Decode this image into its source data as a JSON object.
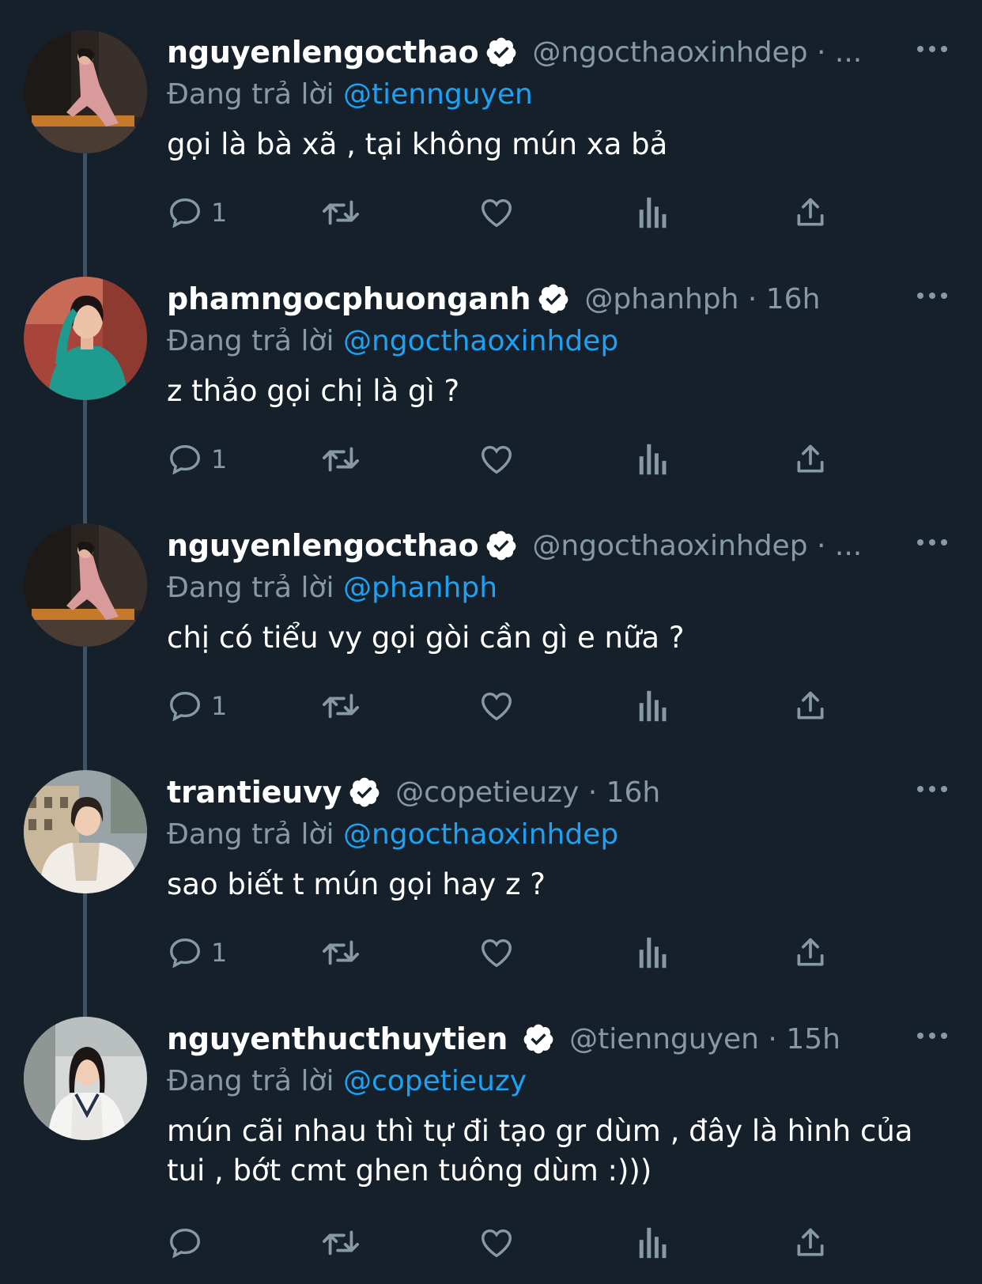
{
  "tweets": [
    {
      "name": "nguyenlengocthao",
      "meta": "@ngocthaoxinhdep · ...",
      "reply_prefix": "Đang trả lời",
      "reply_to": "@tiennguyen",
      "text": "gọi là bà xã , tại không mún xa bả",
      "reply_count": "1",
      "avatar_icon": "avatar-photo-pink-dress"
    },
    {
      "name": "phamngocphuonganh",
      "meta": "@phanhph · 16h",
      "reply_prefix": "Đang trả lời",
      "reply_to": "@ngocthaoxinhdep",
      "text": "z thảo gọi chị là gì ?",
      "reply_count": "1",
      "avatar_icon": "avatar-photo-teal-dress"
    },
    {
      "name": "nguyenlengocthao",
      "meta": "@ngocthaoxinhdep · ...",
      "reply_prefix": "Đang trả lời",
      "reply_to": "@phanhph",
      "text": "chị có tiểu vy gọi gòi cần gì e nữa ?",
      "reply_count": "1",
      "avatar_icon": "avatar-photo-pink-dress"
    },
    {
      "name": "trantieuvy",
      "meta": "@copetieuzy · 16h",
      "reply_prefix": "Đang trả lời",
      "reply_to": "@ngocthaoxinhdep",
      "text": "sao biết t mún gọi hay z ?",
      "reply_count": "1",
      "avatar_icon": "avatar-photo-white-fur"
    },
    {
      "name": "nguyenthucthuytien",
      "meta": "@tiennguyen · 15h",
      "reply_prefix": "Đang trả lời",
      "reply_to": "@copetieuzy",
      "text": "mún cãi nhau thì tự đi tạo gr dùm , đây là hình của tui , bớt cmt ghen tuông dùm :)))",
      "reply_count": "",
      "avatar_icon": "avatar-photo-sweater-vest"
    }
  ],
  "icons": {
    "reply": "reply-icon",
    "retweet": "retweet-icon",
    "like": "like-icon",
    "analytics": "analytics-icon",
    "share": "share-icon",
    "verified": "verified-badge-icon",
    "more": "more-options-icon"
  },
  "colors": {
    "background": "#15202b",
    "secondary_text": "#8899a6",
    "mention": "#1da1f2",
    "thread_line": "#3d5466"
  }
}
